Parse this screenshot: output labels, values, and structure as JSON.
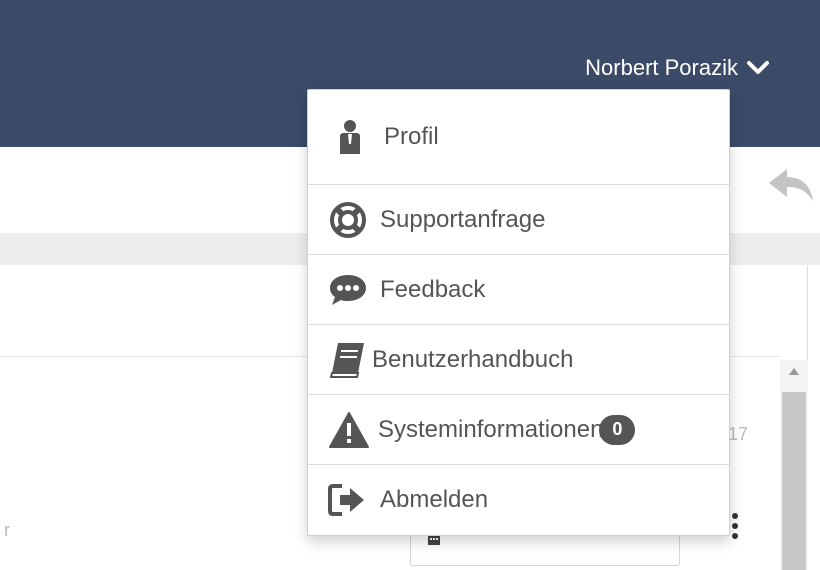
{
  "header": {
    "user_name": "Norbert Porazik"
  },
  "background": {
    "peek_number": "17",
    "peek_letter": "r"
  },
  "user_menu": {
    "items": [
      {
        "label": "Profil",
        "icon": "user-icon"
      },
      {
        "label": "Supportanfrage",
        "icon": "life-ring-icon"
      },
      {
        "label": "Feedback",
        "icon": "comment-icon"
      },
      {
        "label": "Benutzerhandbuch",
        "icon": "book-icon"
      },
      {
        "label": "Systeminformationen",
        "icon": "warning-icon",
        "badge": "0"
      },
      {
        "label": "Abmelden",
        "icon": "sign-out-icon"
      }
    ]
  },
  "colors": {
    "header_bg": "#3b4b67",
    "menu_text": "#555555",
    "icon_color": "#555555"
  }
}
